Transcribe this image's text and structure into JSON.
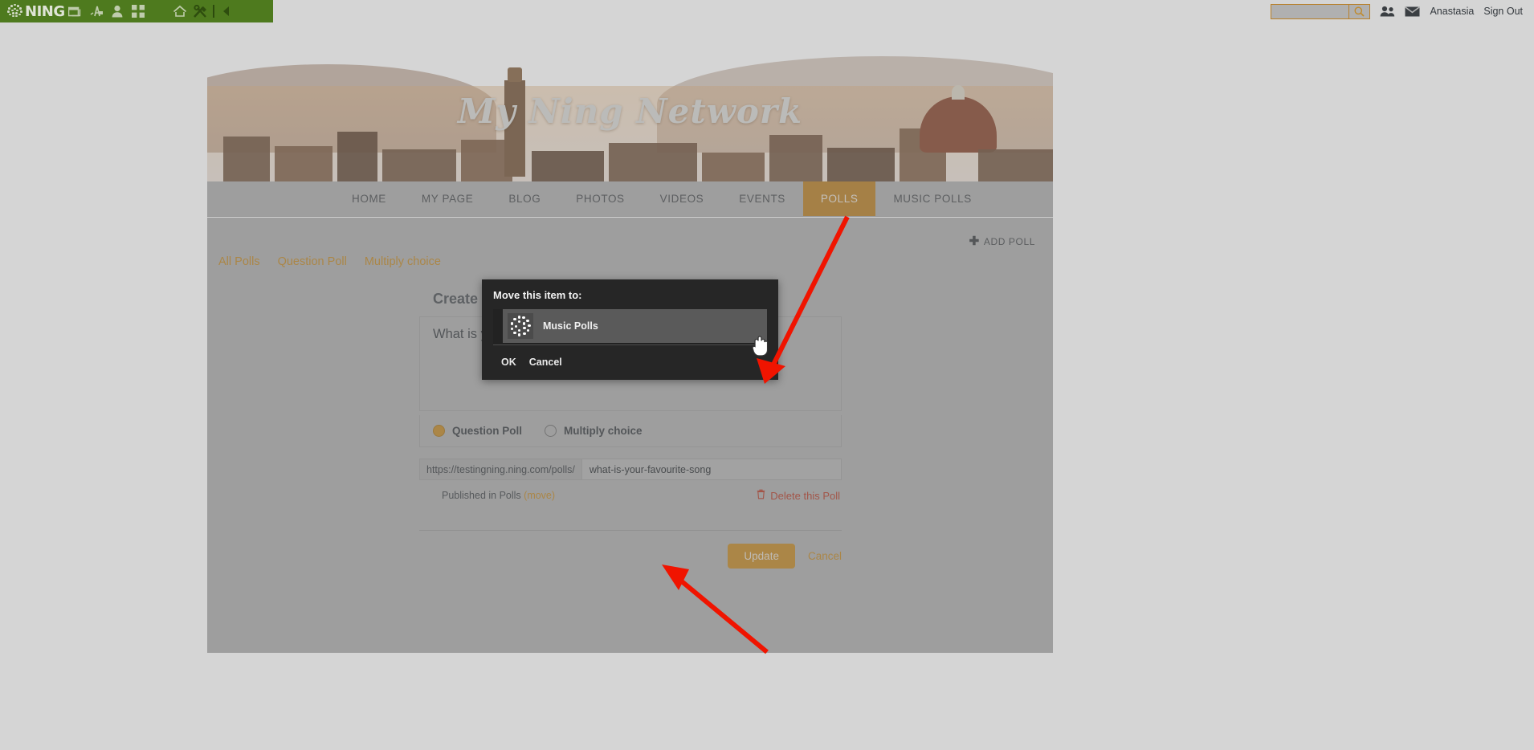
{
  "admin_bar": {
    "logo_text": "NING",
    "icons": [
      {
        "name": "windows-icon",
        "label": "Site Pages"
      },
      {
        "name": "design-icon",
        "label": "Design"
      },
      {
        "name": "person-icon",
        "label": "Members"
      },
      {
        "name": "grid-icon",
        "label": "Apps"
      },
      {
        "name": "home-icon",
        "label": "Home"
      },
      {
        "name": "tools-icon",
        "label": "Tools"
      },
      {
        "name": "collapse-left-icon",
        "label": "Collapse"
      }
    ]
  },
  "top_right": {
    "search_value": "",
    "search_placeholder": "",
    "search_icon": "search-icon",
    "friends_icon": "friends-icon",
    "messages_icon": "envelope-icon",
    "user_name": "Anastasia",
    "sign_out": "Sign Out"
  },
  "banner": {
    "title": "My Ning Network"
  },
  "nav": {
    "items": [
      {
        "label": "HOME",
        "active": false
      },
      {
        "label": "MY PAGE",
        "active": false
      },
      {
        "label": "BLOG",
        "active": false
      },
      {
        "label": "PHOTOS",
        "active": false
      },
      {
        "label": "VIDEOS",
        "active": false
      },
      {
        "label": "EVENTS",
        "active": false
      },
      {
        "label": "POLLS",
        "active": true
      },
      {
        "label": "MUSIC POLLS",
        "active": false
      }
    ]
  },
  "content": {
    "add_poll_label": "ADD POLL",
    "add_poll_plus": "✚",
    "tabs": [
      {
        "label": "All Polls"
      },
      {
        "label": "Question Poll"
      },
      {
        "label": "Multiply choice"
      }
    ],
    "panel_heading": "Create new Poll",
    "poll_question": "What is your favourite song?",
    "poll_type_options": [
      {
        "label": "Question Poll",
        "selected": true
      },
      {
        "label": "Multiply choice",
        "selected": false
      }
    ],
    "url_prefix": "https://testingning.ning.com/polls/",
    "url_slug": "what-is-your-favourite-song",
    "published_text": "Published in Polls",
    "move_link": "(move)",
    "delete_label": "Delete this Poll",
    "delete_icon": "trash-icon",
    "update_label": "Update",
    "cancel_label": "Cancel"
  },
  "modal": {
    "title": "Move this item to:",
    "option_label": "Music Polls",
    "option_icon": "ning-spinner-icon",
    "ok_label": "OK",
    "cancel_label": "Cancel"
  },
  "colors": {
    "brand_green": "#4e7a1e",
    "accent_orange": "#c08a2c",
    "nav_active": "#b8802a",
    "page_gray": "#adadad",
    "modal_dark": "#262626",
    "annotation_red": "#f01400",
    "delete_red": "#b4412f"
  }
}
